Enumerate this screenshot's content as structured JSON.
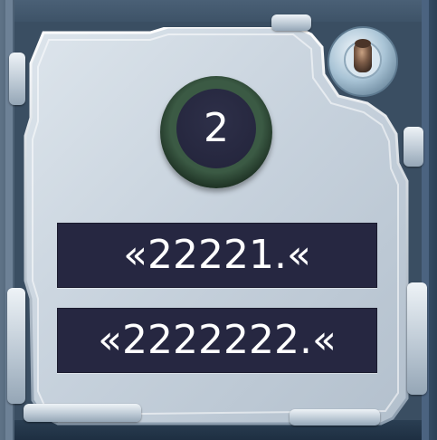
{
  "counter": {
    "value": "2"
  },
  "displays": [
    {
      "text": "«22221.«"
    },
    {
      "text": "«2222222.«"
    }
  ],
  "colors": {
    "panel": "#c9d4de",
    "display_bg": "#262741",
    "display_text": "#ffffff",
    "badge_ring": "#3b5a44",
    "badge_face": "#2a2b44",
    "background": "#3a4e62"
  },
  "icons": {
    "bolt": "bolt-icon"
  }
}
